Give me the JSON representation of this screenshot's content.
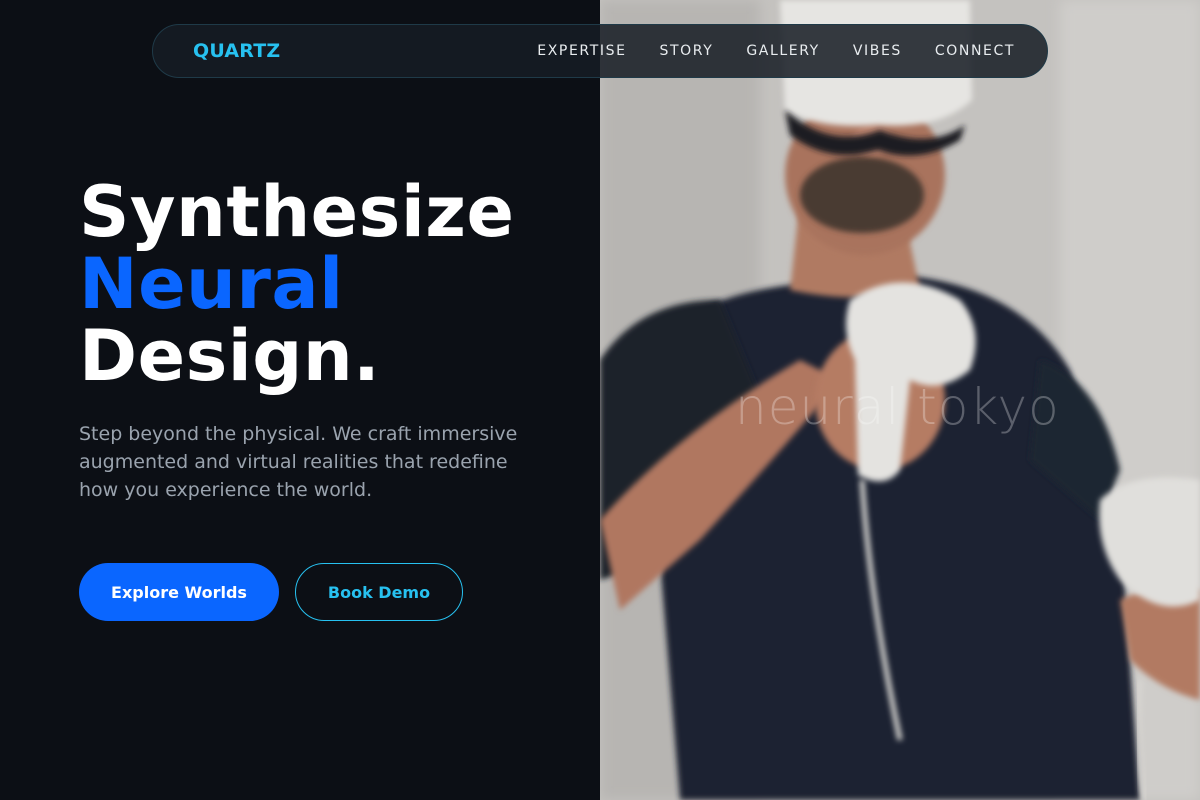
{
  "nav": {
    "logo": "QUARTZ",
    "links": [
      "EXPERTISE",
      "STORY",
      "GALLERY",
      "VIBES",
      "CONNECT"
    ]
  },
  "hero": {
    "title_line1": "Synthesize",
    "title_line2": "Neural",
    "title_line3": "Design.",
    "description": "Step beyond the physical. We craft immersive augmented and virtual realities that redefine how you experience the world.",
    "primary_button": "Explore Worlds",
    "secondary_button": "Book Demo"
  },
  "photo": {
    "watermark": "neural tokyo"
  },
  "colors": {
    "background": "#0c0f15",
    "accent_blue": "#0a66ff",
    "accent_cyan": "#27c1f0",
    "muted_text": "#9aa3ae"
  }
}
